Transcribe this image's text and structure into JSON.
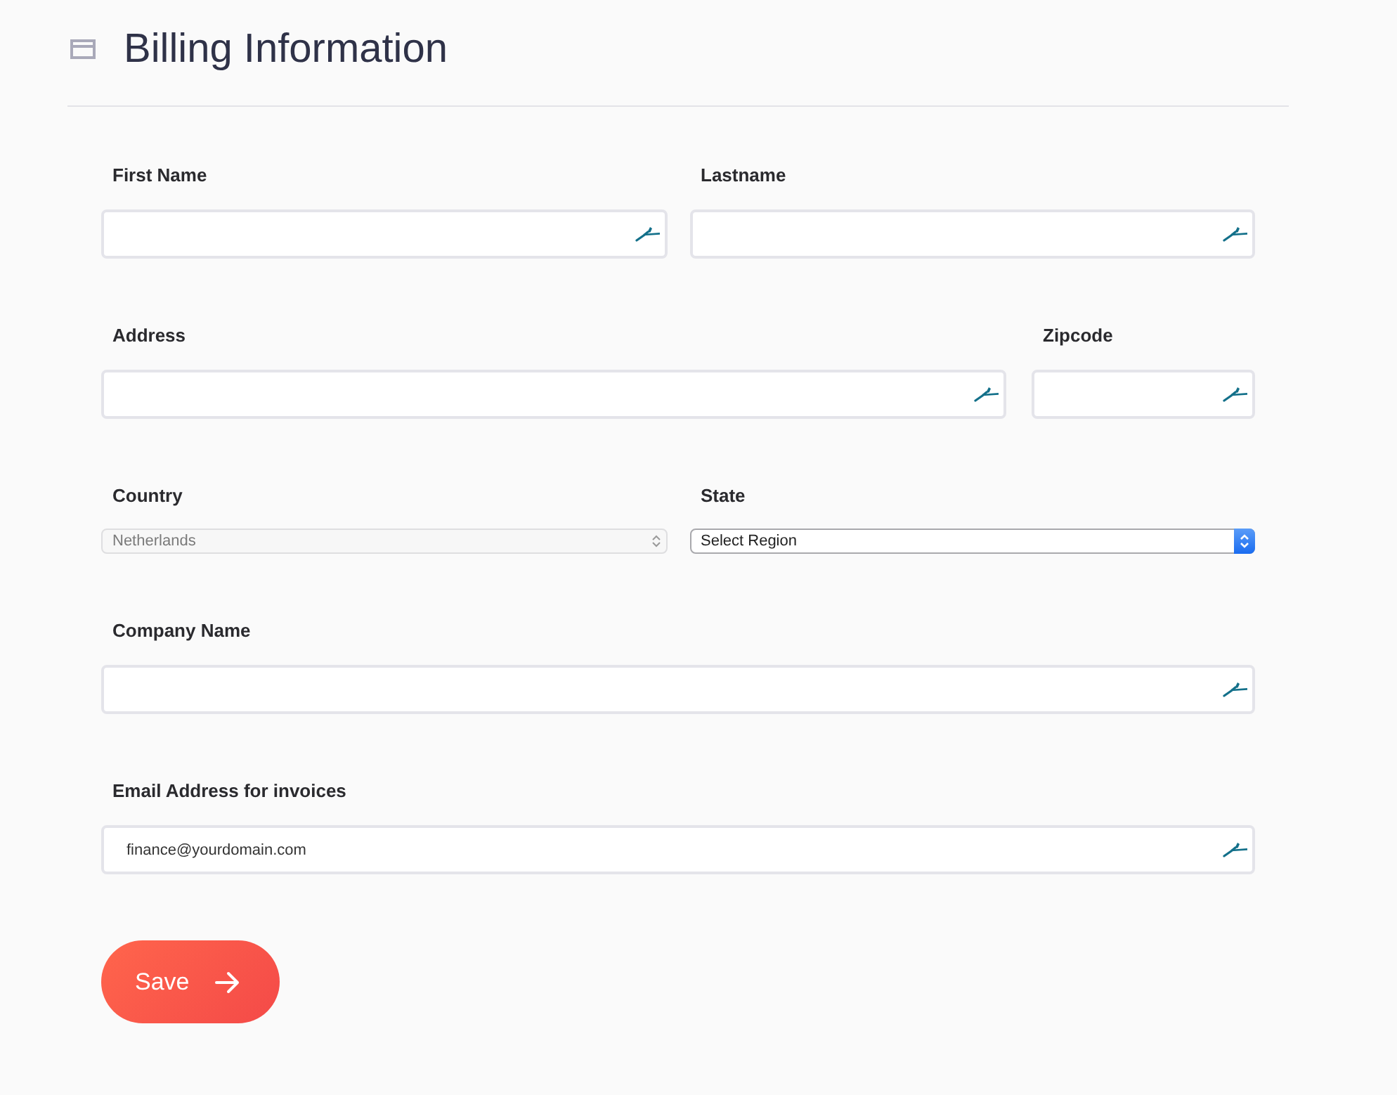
{
  "header": {
    "title": "Billing Information"
  },
  "form": {
    "rows": [
      {
        "fields": [
          {
            "kind": "text",
            "label": "First Name"
          },
          {
            "kind": "text",
            "label": "Lastname"
          }
        ]
      },
      {
        "fields": [
          {
            "kind": "text",
            "label": "Address"
          },
          {
            "kind": "text",
            "label": "Zipcode"
          }
        ]
      },
      {
        "fields": [
          {
            "kind": "select",
            "label": "Country",
            "value": "Netherlands",
            "disabled": true
          },
          {
            "kind": "select",
            "label": "State",
            "value": "Select Region",
            "disabled": false
          }
        ]
      },
      {
        "fields": [
          {
            "kind": "text",
            "label": "Company Name"
          }
        ]
      },
      {
        "fields": [
          {
            "kind": "text",
            "label": "Email Address for invoices",
            "value": "finance@yourdomain.com"
          }
        ]
      }
    ]
  },
  "save_button": {
    "label": "Save"
  }
}
